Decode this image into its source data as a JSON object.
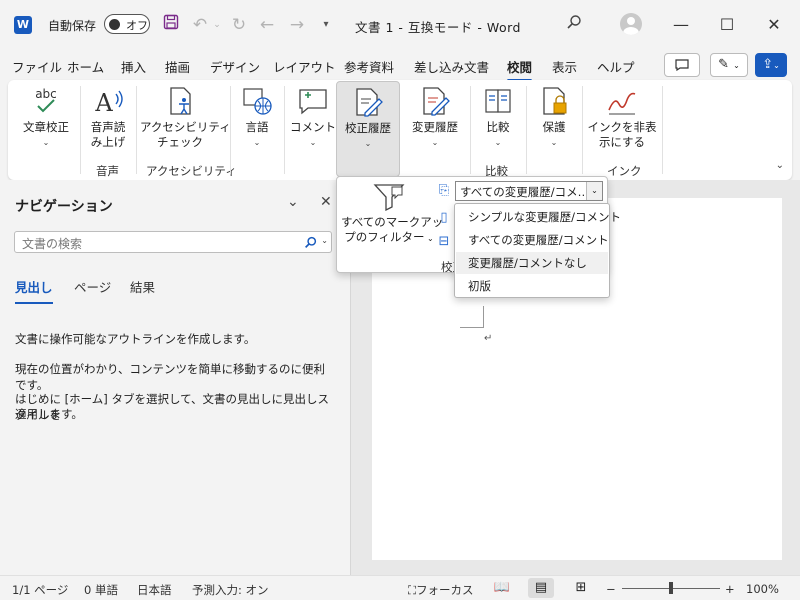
{
  "titlebar": {
    "logo": "W",
    "autosave_label": "自動保存",
    "autosave_state": "オフ",
    "document_title": "文書 1  -  互換モード  -  Word",
    "icons": [
      "save-icon",
      "undo-icon",
      "redo-icon",
      "back-icon",
      "forward-icon",
      "customize-icon",
      "search-icon",
      "account-icon",
      "minimize-icon",
      "maximize-icon",
      "close-icon"
    ]
  },
  "menu": {
    "items": [
      "ファイル",
      "ホーム",
      "挿入",
      "描画",
      "デザイン",
      "レイアウト",
      "参考資料",
      "差し込み文書",
      "校閲",
      "表示",
      "ヘルプ"
    ],
    "active": "校閲"
  },
  "ribbon": {
    "buttons": {
      "spelling": "文章校正",
      "read_aloud_1": "音声読",
      "read_aloud_2": "み上げ",
      "accessibility_1": "アクセシビリティ",
      "accessibility_2": "チェック",
      "language": "言語",
      "comment": "コメント",
      "tracking": "校正履歴",
      "changes": "変更履歴",
      "compare": "比較",
      "protect": "保護",
      "hide_ink_1": "インクを非表",
      "hide_ink_2": "示にする"
    },
    "groups": {
      "voice": "音声",
      "accessibility": "アクセシビリティ",
      "compare": "比較",
      "ink": "インク"
    },
    "spelling_icon_text": "abc"
  },
  "navigation": {
    "title": "ナビゲーション",
    "search_placeholder": "文書の検索",
    "tabs": [
      "見出し",
      "ページ",
      "結果"
    ],
    "active_tab": "見出し",
    "texts": [
      "文書に操作可能なアウトラインを作成します。",
      "現在の位置がわかり、コンテンツを簡単に移動するのに便利です。",
      "はじめに [ホーム] タブを選択して、文書の見出しに見出しスタイルを",
      "適用します。"
    ]
  },
  "markup_popup": {
    "filter_label_1": "すべてのマークアッ",
    "filter_label_2": "プのフィルター",
    "combo_value": "すべての変更履歴/コメ…",
    "group_label": "校正",
    "options": [
      "シンプルな変更履歴/コメント",
      "すべての変更履歴/コメント",
      "変更履歴/コメントなし",
      "初版"
    ],
    "highlighted_option": "変更履歴/コメントなし"
  },
  "statusbar": {
    "page": "1/1 ページ",
    "words": "0 単語",
    "language": "日本語",
    "prediction": "予測入力: オン",
    "focus": "フォーカス",
    "zoom": "100%",
    "zoom_minus": "−",
    "zoom_plus": "+",
    "zoom_level": 100
  },
  "colors": {
    "accent": "#185abd",
    "background": "#f3f3f3"
  }
}
